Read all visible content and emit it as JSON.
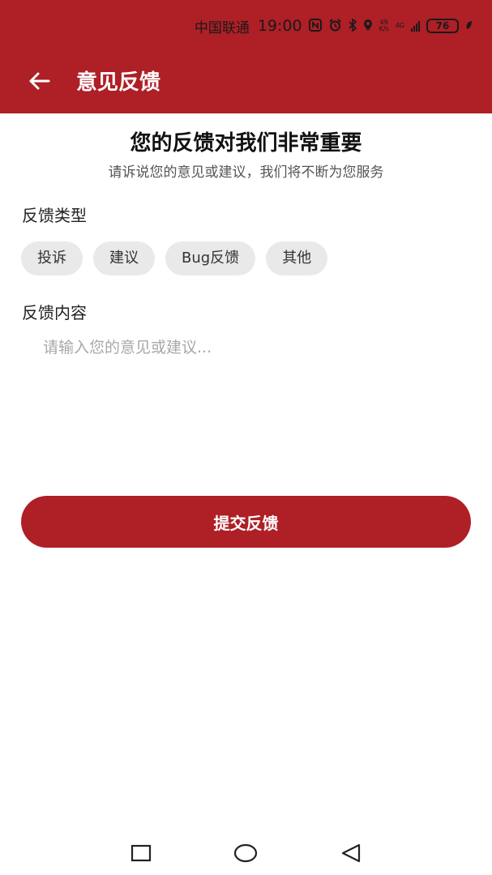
{
  "status_bar": {
    "carrier": "中国联通",
    "time": "19:00",
    "speed_value": "49",
    "speed_unit": "K/s",
    "network": "4G",
    "battery": "76"
  },
  "app_bar": {
    "title": "意见反馈"
  },
  "intro": {
    "headline": "您的反馈对我们非常重要",
    "subline": "请诉说您的意见或建议，我们将不断为您服务"
  },
  "feedback_type": {
    "label": "反馈类型",
    "options": [
      "投诉",
      "建议",
      "Bug反馈",
      "其他"
    ]
  },
  "feedback_content": {
    "label": "反馈内容",
    "placeholder": "请输入您的意见或建议...",
    "value": ""
  },
  "submit": {
    "label": "提交反馈"
  },
  "colors": {
    "primary": "#ae1f26",
    "chip_bg": "#e9e9e9",
    "placeholder": "#a8a8a8"
  }
}
